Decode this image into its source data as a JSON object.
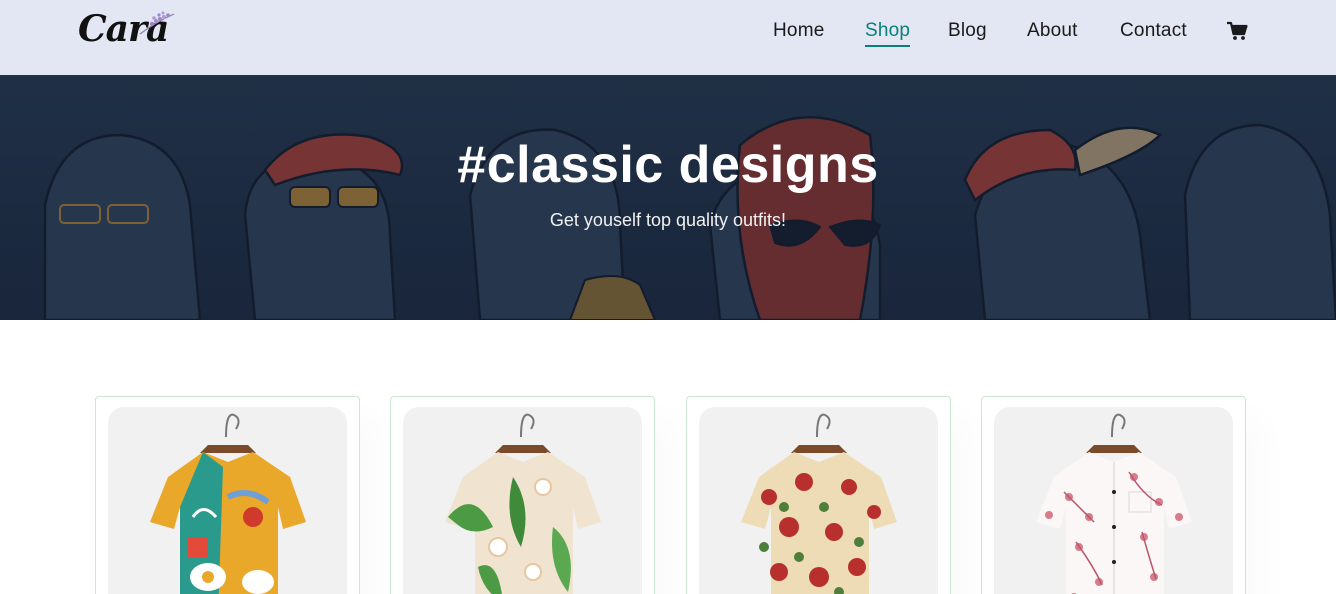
{
  "brand": {
    "logo_text": "Cara"
  },
  "nav": {
    "items": [
      {
        "label": "Home",
        "active": false
      },
      {
        "label": "Shop",
        "active": true
      },
      {
        "label": "Blog",
        "active": false
      },
      {
        "label": "About",
        "active": false
      },
      {
        "label": "Contact",
        "active": false
      }
    ],
    "cart_icon": "shopping-cart-icon"
  },
  "hero": {
    "title": "#classic designs",
    "subtitle": "Get youself top quality outfits!"
  },
  "products": [
    {
      "image": "multicolor-pattern-shirt"
    },
    {
      "image": "green-leaf-print-shirt"
    },
    {
      "image": "red-floral-print-shirt"
    },
    {
      "image": "pink-blossom-print-shirt"
    }
  ],
  "colors": {
    "accent": "#088178",
    "header_bg": "#e3e6f3",
    "hero_overlay": "#1c2a3f",
    "card_border": "#cce7d0"
  }
}
